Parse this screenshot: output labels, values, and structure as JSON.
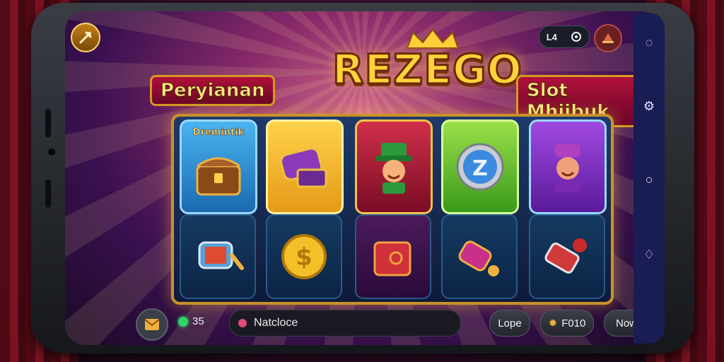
{
  "title": {
    "left": "Peryianan",
    "main": "REZEGO",
    "right": "Slot Mhiibuk"
  },
  "reels": [
    {
      "top_symbol": "chest-icon",
      "top_label": "Dremintik",
      "bottom_symbol": "reel-cylinder-icon",
      "top_color": "#3aa0e8"
    },
    {
      "top_symbol": "ticket-roll-icon",
      "top_label": "",
      "bottom_symbol": "dollar-coin-icon",
      "top_color": "#f4b82a"
    },
    {
      "top_symbol": "leprechaun-icon",
      "top_label": "",
      "bottom_symbol": "red-box-icon",
      "top_color": "#c0243a"
    },
    {
      "top_symbol": "silver-coin-icon",
      "top_label": "",
      "bottom_symbol": "pink-cylinder-icon",
      "top_color": "#7ad02a"
    },
    {
      "top_symbol": "jester-icon",
      "top_label": "",
      "bottom_symbol": "red-cylinder-icon",
      "top_color": "#8a3ad0"
    }
  ],
  "top_right": {
    "status_text": "L4",
    "profile_icon": "hat-avatar-icon"
  },
  "top_left": {
    "icon": "tools-icon"
  },
  "bottom_bar": {
    "mail_icon": "envelope-icon",
    "online_count": "35",
    "message_text": "Natcloce",
    "left_button": "Lope",
    "middle_button": "F010",
    "right_button": "Now"
  },
  "colors": {
    "accent_gold": "#ffd23a",
    "navbar": "#1a1c54",
    "online_green": "#2fd36a",
    "message_dot": "#e04a7a"
  }
}
